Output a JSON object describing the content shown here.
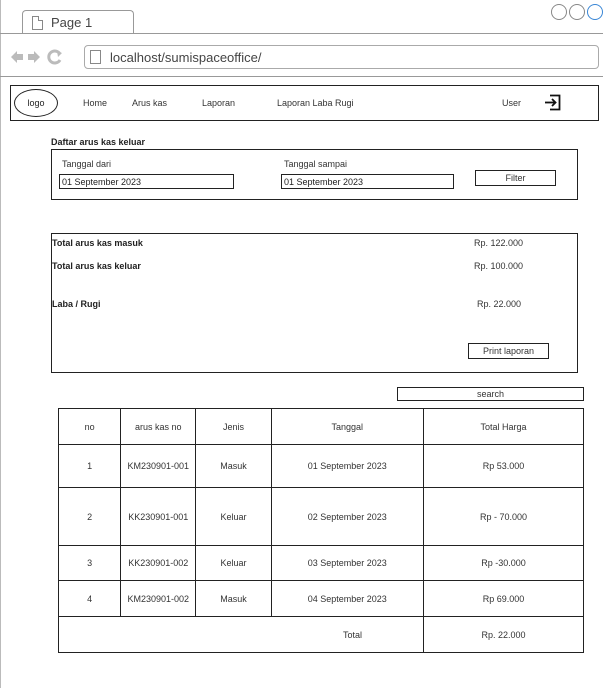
{
  "browser": {
    "tab_title": "Page 1",
    "url": "localhost/sumispaceoffice/"
  },
  "navbar": {
    "logo": "logo",
    "items": [
      "Home",
      "Arus kas",
      "Laporan",
      "Laporan Laba Rugi"
    ],
    "user": "User"
  },
  "filter": {
    "title": "Daftar arus kas keluar",
    "from_label": "Tanggal dari",
    "from_value": "01 September 2023",
    "to_label": "Tanggal sampai",
    "to_value": "01 September 2023",
    "filter_button": "Filter"
  },
  "summary": {
    "in_label": "Total arus kas masuk",
    "in_value": "Rp. 122.000",
    "out_label": "Total arus kas keluar",
    "out_value": "Rp. 100.000",
    "pl_label": "Laba / Rugi",
    "pl_value": "Rp. 22.000",
    "print_button": "Print laporan"
  },
  "search": {
    "placeholder": "search"
  },
  "table": {
    "headers": [
      "no",
      "arus kas no",
      "Jenis",
      "Tanggal",
      "Total Harga"
    ],
    "rows": [
      [
        "1",
        "KM230901-001",
        "Masuk",
        "01 September 2023",
        "Rp 53.000"
      ],
      [
        "2",
        "KK230901-001",
        "Keluar",
        "02 September 2023",
        "Rp - 70.000"
      ],
      [
        "3",
        "KK230901-002",
        "Keluar",
        "03 September 2023",
        "Rp -30.000"
      ],
      [
        "4",
        "KM230901-002",
        "Masuk",
        "04 September 2023",
        "Rp 69.000"
      ]
    ],
    "total_label": "Total",
    "total_value": "Rp. 22.000"
  }
}
